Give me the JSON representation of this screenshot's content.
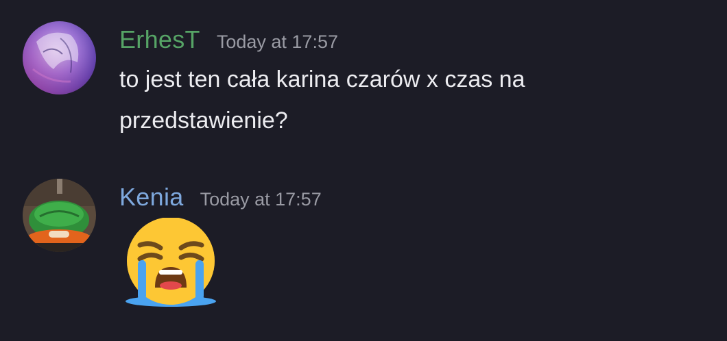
{
  "messages": [
    {
      "author": "ErhesT",
      "author_color": "#56a466",
      "timestamp": "Today at 17:57",
      "text": "to jest ten cała karina czarów x czas na przedstawienie?",
      "avatar": "purple-anime-avatar"
    },
    {
      "author": "Kenia",
      "author_color": "#7ea8dd",
      "timestamp": "Today at 17:57",
      "emoji": "loudly-crying-face-emoji",
      "avatar": "green-hat-cartoon-avatar"
    }
  ],
  "colors": {
    "background": "#1c1c26",
    "timestamp": "#9a9ba4",
    "text": "#ececf0"
  }
}
